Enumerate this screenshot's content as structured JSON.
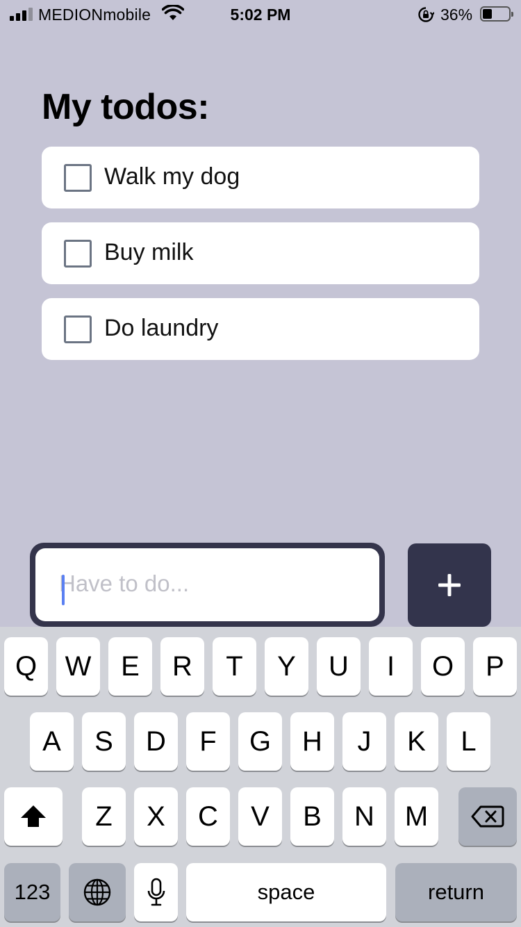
{
  "status_bar": {
    "carrier": "MEDIONmobile",
    "time": "5:02 PM",
    "battery_percent": "36%",
    "battery_level": 0.36,
    "signal_bars": 3,
    "signal_bars_total": 4
  },
  "page": {
    "title": "My todos:"
  },
  "todos": [
    {
      "label": "Walk my dog",
      "checked": false
    },
    {
      "label": "Buy milk",
      "checked": false
    },
    {
      "label": "Do laundry",
      "checked": false
    }
  ],
  "new_todo": {
    "value": "",
    "placeholder": "Have to do..."
  },
  "add_button": {
    "icon": "plus-icon"
  },
  "keyboard": {
    "row1": [
      "Q",
      "W",
      "E",
      "R",
      "T",
      "Y",
      "U",
      "I",
      "O",
      "P"
    ],
    "row2": [
      "A",
      "S",
      "D",
      "F",
      "G",
      "H",
      "J",
      "K",
      "L"
    ],
    "row3": [
      "Z",
      "X",
      "C",
      "V",
      "B",
      "N",
      "M"
    ],
    "shift_icon": "shift-icon",
    "backspace_icon": "backspace-icon",
    "numbers_label": "123",
    "globe_icon": "globe-icon",
    "mic_icon": "microphone-icon",
    "space_label": "space",
    "return_label": "return"
  },
  "colors": {
    "background": "#c5c4d5",
    "accent_dark": "#34344b",
    "caret": "#5b80f2"
  }
}
